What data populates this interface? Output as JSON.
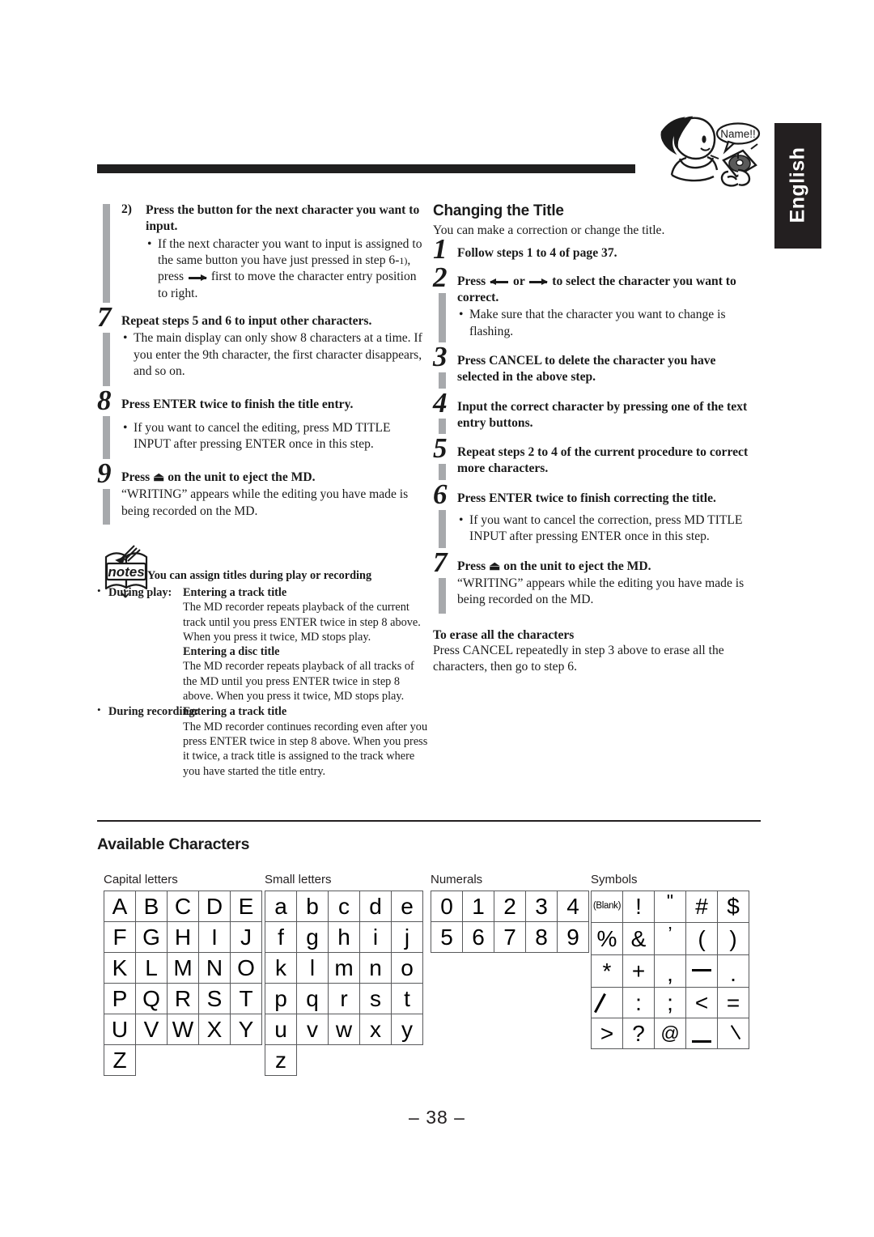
{
  "language_tab": "English",
  "mascot": {
    "speech_bubble": "Name!!"
  },
  "page_number": "– 38 –",
  "left_column": {
    "substep": {
      "marker": "2)",
      "heading": "Press the button for the next character you want to input.",
      "bullets": [
        "If the next character you want to input is assigned to the same button you have just pressed in step 6-1), press → first to move the character entry position to right."
      ]
    },
    "steps": [
      {
        "number": "7",
        "heading": "Repeat steps 5 and 6 to input other characters.",
        "bullets": [
          "The main display can only show 8 characters at a time. If you enter the 9th character, the first character disappears, and so on."
        ],
        "body": ""
      },
      {
        "number": "8",
        "heading": "Press ENTER twice to finish the title entry.",
        "bullets": [
          "If you want to cancel the editing, press MD TITLE INPUT after pressing ENTER once in this step."
        ],
        "body": ""
      },
      {
        "number": "9",
        "heading": "Press ⏏ on the unit to eject the MD.",
        "bullets": [],
        "body": "“WRITING” appears while the editing you have made is being recorded on the MD."
      }
    ],
    "notes": {
      "icon_label": "notes",
      "title": "You can assign titles during play or recording",
      "entries": [
        {
          "label": "During play:",
          "sections": [
            {
              "subtitle": "Entering a track title",
              "text": "The MD recorder repeats playback of the current track until you press ENTER twice in step 8 above. When you press it twice, MD stops play."
            },
            {
              "subtitle": "Entering a disc title",
              "text": "The MD recorder repeats playback of all tracks of the MD until you press ENTER twice in step 8 above. When you press it twice, MD stops play."
            }
          ]
        },
        {
          "label": "During recording:",
          "sections": [
            {
              "subtitle": "Entering a track title",
              "text": "The MD recorder continues recording even after you press ENTER twice in step 8 above. When you press it twice, a track title is assigned to the track where you have started the title entry."
            }
          ]
        }
      ]
    }
  },
  "right_column": {
    "heading": "Changing the Title",
    "intro": "You can make a correction or change the title.",
    "steps": [
      {
        "number": "1",
        "heading": "Follow steps 1 to 4 of page 37.",
        "bullets": [],
        "body": ""
      },
      {
        "number": "2",
        "heading_pre": "Press",
        "heading_mid": "or",
        "heading_post": "to select the character you want to correct.",
        "bullets": [
          "Make sure that the character you want to change is flashing."
        ],
        "body": ""
      },
      {
        "number": "3",
        "heading": "Press CANCEL to delete the character you have selected in the above step.",
        "bullets": [],
        "body": ""
      },
      {
        "number": "4",
        "heading": "Input the correct character by pressing one of the text entry buttons.",
        "bullets": [],
        "body": ""
      },
      {
        "number": "5",
        "heading": "Repeat steps 2 to 4 of the current procedure to correct more characters.",
        "bullets": [],
        "body": ""
      },
      {
        "number": "6",
        "heading": "Press ENTER twice to finish correcting the title.",
        "bullets": [
          "If you want to cancel the correction, press MD TITLE INPUT after pressing ENTER once in this step."
        ],
        "body": ""
      },
      {
        "number": "7",
        "heading": "Press ⏏ on the unit to eject the MD.",
        "bullets": [],
        "body": "“WRITING” appears while the editing you have made is being recorded on the MD."
      }
    ],
    "erase_all": {
      "heading": "To erase all the characters",
      "body": "Press CANCEL repeatedly in step 3 above to erase all the characters, then go to step 6."
    }
  },
  "available_characters": {
    "heading": "Available Characters",
    "tables": [
      {
        "label": "Capital letters",
        "rows": [
          [
            "A",
            "B",
            "C",
            "D",
            "E"
          ],
          [
            "F",
            "G",
            "H",
            "I",
            "J"
          ],
          [
            "K",
            "L",
            "M",
            "N",
            "O"
          ],
          [
            "P",
            "Q",
            "R",
            "S",
            "T"
          ],
          [
            "U",
            "V",
            "W",
            "X",
            "Y"
          ],
          [
            "Z",
            "",
            "",
            "",
            ""
          ]
        ]
      },
      {
        "label": "Small letters",
        "rows": [
          [
            "a",
            "b",
            "c",
            "d",
            "e"
          ],
          [
            "f",
            "g",
            "h",
            "i",
            "j"
          ],
          [
            "k",
            "l",
            "m",
            "n",
            "o"
          ],
          [
            "p",
            "q",
            "r",
            "s",
            "t"
          ],
          [
            "u",
            "v",
            "w",
            "x",
            "y"
          ],
          [
            "z",
            "",
            "",
            "",
            ""
          ]
        ]
      },
      {
        "label": "Numerals",
        "rows": [
          [
            "0",
            "1",
            "2",
            "3",
            "4"
          ],
          [
            "5",
            "6",
            "7",
            "8",
            "9"
          ]
        ]
      },
      {
        "label": "Symbols",
        "rows": [
          [
            "(Blank)",
            "!",
            "\"",
            "#",
            "$"
          ],
          [
            "%",
            "&",
            "’",
            "(",
            ")"
          ],
          [
            "*",
            "+",
            ",",
            "—",
            "."
          ],
          [
            "/",
            ":",
            ";",
            "<",
            "="
          ],
          [
            ">",
            "?",
            "@",
            "_",
            "\\"
          ]
        ]
      }
    ]
  }
}
